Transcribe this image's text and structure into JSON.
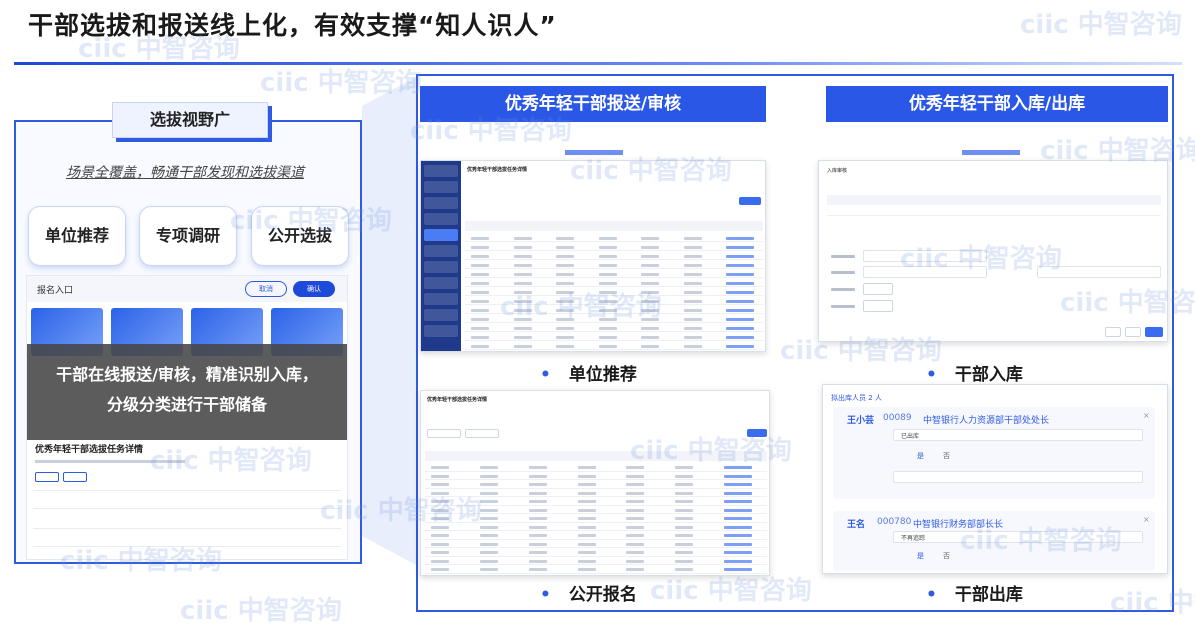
{
  "header": {
    "title": "干部选拔和报送线上化，有效支撑“知人识人”"
  },
  "watermark": "ciic 中智咨询",
  "left": {
    "tag": "选拔视野广",
    "subtitle": "场景全覆盖，畅通干部发现和选拔渠道",
    "tiles": [
      "单位推荐",
      "专项调研",
      "公开选拔"
    ],
    "mini": {
      "bar_label": "报名入口",
      "cancel": "取消",
      "confirm": "确认",
      "overlay_line1": "干部在线报送/审核，精准识别入库，",
      "overlay_line2": "分级分类进行干部储备",
      "detail_title": "优秀年轻干部选拔任务详情"
    }
  },
  "right": {
    "heads": [
      "优秀年轻干部报送/审核",
      "优秀年轻干部入库/出库"
    ],
    "captions": [
      "单位推荐",
      "干部入库",
      "公开报名",
      "干部出库"
    ],
    "bullet": "•",
    "shots": {
      "recommend_title": "优秀年轻干部选拔任务详情",
      "storage_title": "入库审核",
      "public_title": "优秀年轻干部选拔任务详情",
      "out_title": "拟出库人员 2 人",
      "person1_name": "王小芸",
      "person1_id": "00089",
      "person1_org": "中智银行人力资源部干部处处长",
      "person1_status": "已出库",
      "person2_name": "王名",
      "person2_id": "000780",
      "person2_org": "中智银行财务部部长长",
      "person2_status": "不再追踪",
      "yes": "是",
      "no": "否"
    }
  },
  "colors": {
    "accent": "#2b57e6",
    "panel_border": "#2f5be0"
  }
}
